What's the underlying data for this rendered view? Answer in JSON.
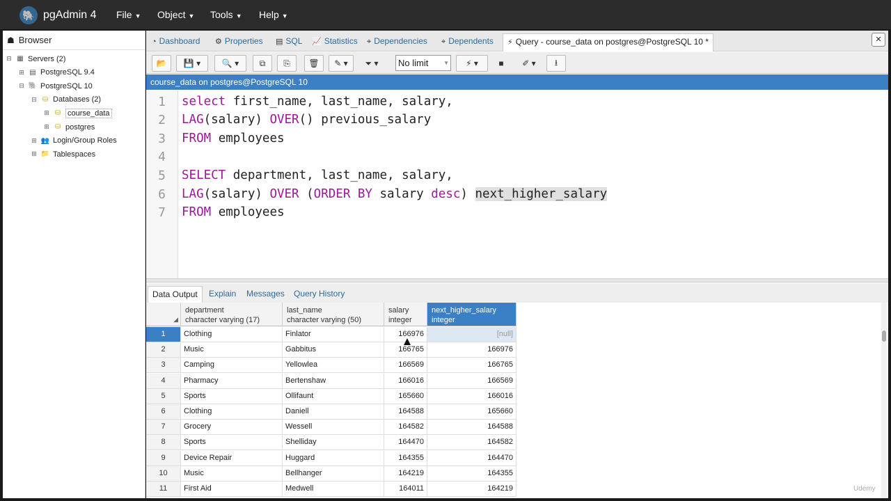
{
  "app": {
    "name": "pgAdmin 4",
    "menus": [
      "File",
      "Object",
      "Tools",
      "Help"
    ]
  },
  "browser": {
    "title": "Browser",
    "tree": [
      {
        "label": "Servers (2)",
        "toggle": "⊟",
        "depth": 0,
        "icon": "servers-icon"
      },
      {
        "label": "PostgreSQL 9.4",
        "toggle": "⊞",
        "depth": 1,
        "icon": "server-disconnected-icon"
      },
      {
        "label": "PostgreSQL 10",
        "toggle": "⊟",
        "depth": 1,
        "icon": "elephant-icon"
      },
      {
        "label": "Databases (2)",
        "toggle": "⊟",
        "depth": 2,
        "icon": "databases-icon"
      },
      {
        "label": "course_data",
        "toggle": "⊞",
        "depth": 3,
        "icon": "database-icon",
        "selected": true
      },
      {
        "label": "postgres",
        "toggle": "⊞",
        "depth": 3,
        "icon": "database-icon"
      },
      {
        "label": "Login/Group Roles",
        "toggle": "⊞",
        "depth": 2,
        "icon": "roles-icon"
      },
      {
        "label": "Tablespaces",
        "toggle": "⊞",
        "depth": 2,
        "icon": "tablespaces-icon"
      }
    ]
  },
  "tabs": [
    {
      "label": "Dashboard",
      "icon": "dashboard-icon"
    },
    {
      "label": "Properties",
      "icon": "properties-icon"
    },
    {
      "label": "SQL",
      "icon": "sql-icon"
    },
    {
      "label": "Statistics",
      "icon": "statistics-icon"
    },
    {
      "label": "Dependencies",
      "icon": "dependencies-icon"
    },
    {
      "label": "Dependents",
      "icon": "dependents-icon"
    },
    {
      "label": "Query - course_data on postgres@PostgreSQL 10 *",
      "icon": "lightning-icon",
      "active": true
    }
  ],
  "toolbar": {
    "limit_value": "No limit"
  },
  "connection": "course_data on postgres@PostgreSQL 10",
  "editor": {
    "lines": [
      "1",
      "2",
      "3",
      "4",
      "5",
      "6",
      "7"
    ]
  },
  "result_tabs": [
    "Data Output",
    "Explain",
    "Messages",
    "Query History"
  ],
  "grid": {
    "columns": [
      {
        "name": "department",
        "type": "character varying (17)"
      },
      {
        "name": "last_name",
        "type": "character varying (50)"
      },
      {
        "name": "salary",
        "type": "integer"
      },
      {
        "name": "next_higher_salary",
        "type": "integer"
      }
    ],
    "rows": [
      {
        "n": "1",
        "department": "Clothing",
        "last_name": "Finlator",
        "salary": "166976",
        "next": "[null]"
      },
      {
        "n": "2",
        "department": "Music",
        "last_name": "Gabbitus",
        "salary": "166765",
        "next": "166976"
      },
      {
        "n": "3",
        "department": "Camping",
        "last_name": "Yellowlea",
        "salary": "166569",
        "next": "166765"
      },
      {
        "n": "4",
        "department": "Pharmacy",
        "last_name": "Bertenshaw",
        "salary": "166016",
        "next": "166569"
      },
      {
        "n": "5",
        "department": "Sports",
        "last_name": "Ollifaunt",
        "salary": "165660",
        "next": "166016"
      },
      {
        "n": "6",
        "department": "Clothing",
        "last_name": "Daniell",
        "salary": "164588",
        "next": "165660"
      },
      {
        "n": "7",
        "department": "Grocery",
        "last_name": "Wessell",
        "salary": "164582",
        "next": "164588"
      },
      {
        "n": "8",
        "department": "Sports",
        "last_name": "Shelliday",
        "salary": "164470",
        "next": "164582"
      },
      {
        "n": "9",
        "department": "Device Repair",
        "last_name": "Huggard",
        "salary": "164355",
        "next": "164470"
      },
      {
        "n": "10",
        "department": "Music",
        "last_name": "Bellhanger",
        "salary": "164219",
        "next": "164355"
      },
      {
        "n": "11",
        "department": "First Aid",
        "last_name": "Medwell",
        "salary": "164011",
        "next": "164219"
      }
    ]
  },
  "watermark": "Udemy"
}
